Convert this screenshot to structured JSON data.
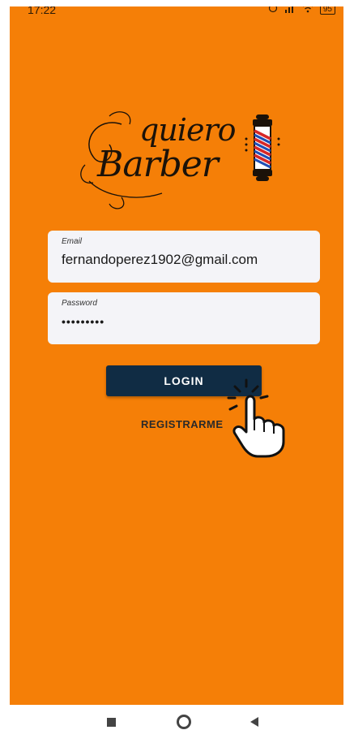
{
  "status_bar": {
    "time": "17:22",
    "battery": "95"
  },
  "logo": {
    "line1": "quiero",
    "line2": "Barber"
  },
  "login_form": {
    "email": {
      "label": "Email",
      "value": "fernandoperez1902@gmail.com"
    },
    "password": {
      "label": "Password",
      "value": "•••••••••"
    },
    "login_label": "LOGIN",
    "register_label": "REGISTRARME"
  },
  "colors": {
    "background": "#f57f07",
    "button": "#102c44",
    "field": "#f4f4f8"
  },
  "icons": [
    "alarm-icon",
    "wifi-icon",
    "signal-icon",
    "battery-icon",
    "barber-pole-icon",
    "tap-hand-icon",
    "recents-icon",
    "home-icon",
    "back-icon"
  ]
}
